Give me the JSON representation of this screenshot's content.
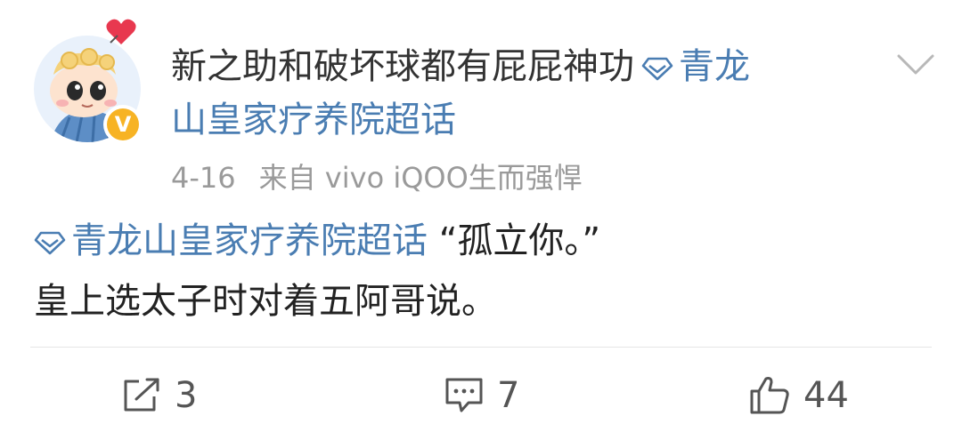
{
  "post": {
    "author_name": "新之助和破坏球都有屁屁神功",
    "topic_line1": "青龙",
    "topic_line2": "山皇家疗养院超话",
    "date": "4-16",
    "source": "来自 vivo iQOO生而强悍",
    "body_topic": "青龙山皇家疗养院超话",
    "body_quote": " “孤立你。”",
    "body_line2": "皇上选太子时对着五阿哥说。"
  },
  "icons": {
    "avatar": "cartoon-avatar",
    "verify": "verified-badge-icon",
    "topic": "diamond-topic-icon",
    "more": "chevron-down-icon",
    "repost": "repost-icon",
    "comment": "comment-icon",
    "like": "thumbs-up-icon"
  },
  "verify_mark": "V",
  "actions": {
    "repost_count": "3",
    "comment_count": "7",
    "like_count": "44"
  },
  "colors": {
    "link": "#4a7db2",
    "text": "#222222",
    "meta": "#9a9a9a",
    "badge": "#f7b324"
  }
}
